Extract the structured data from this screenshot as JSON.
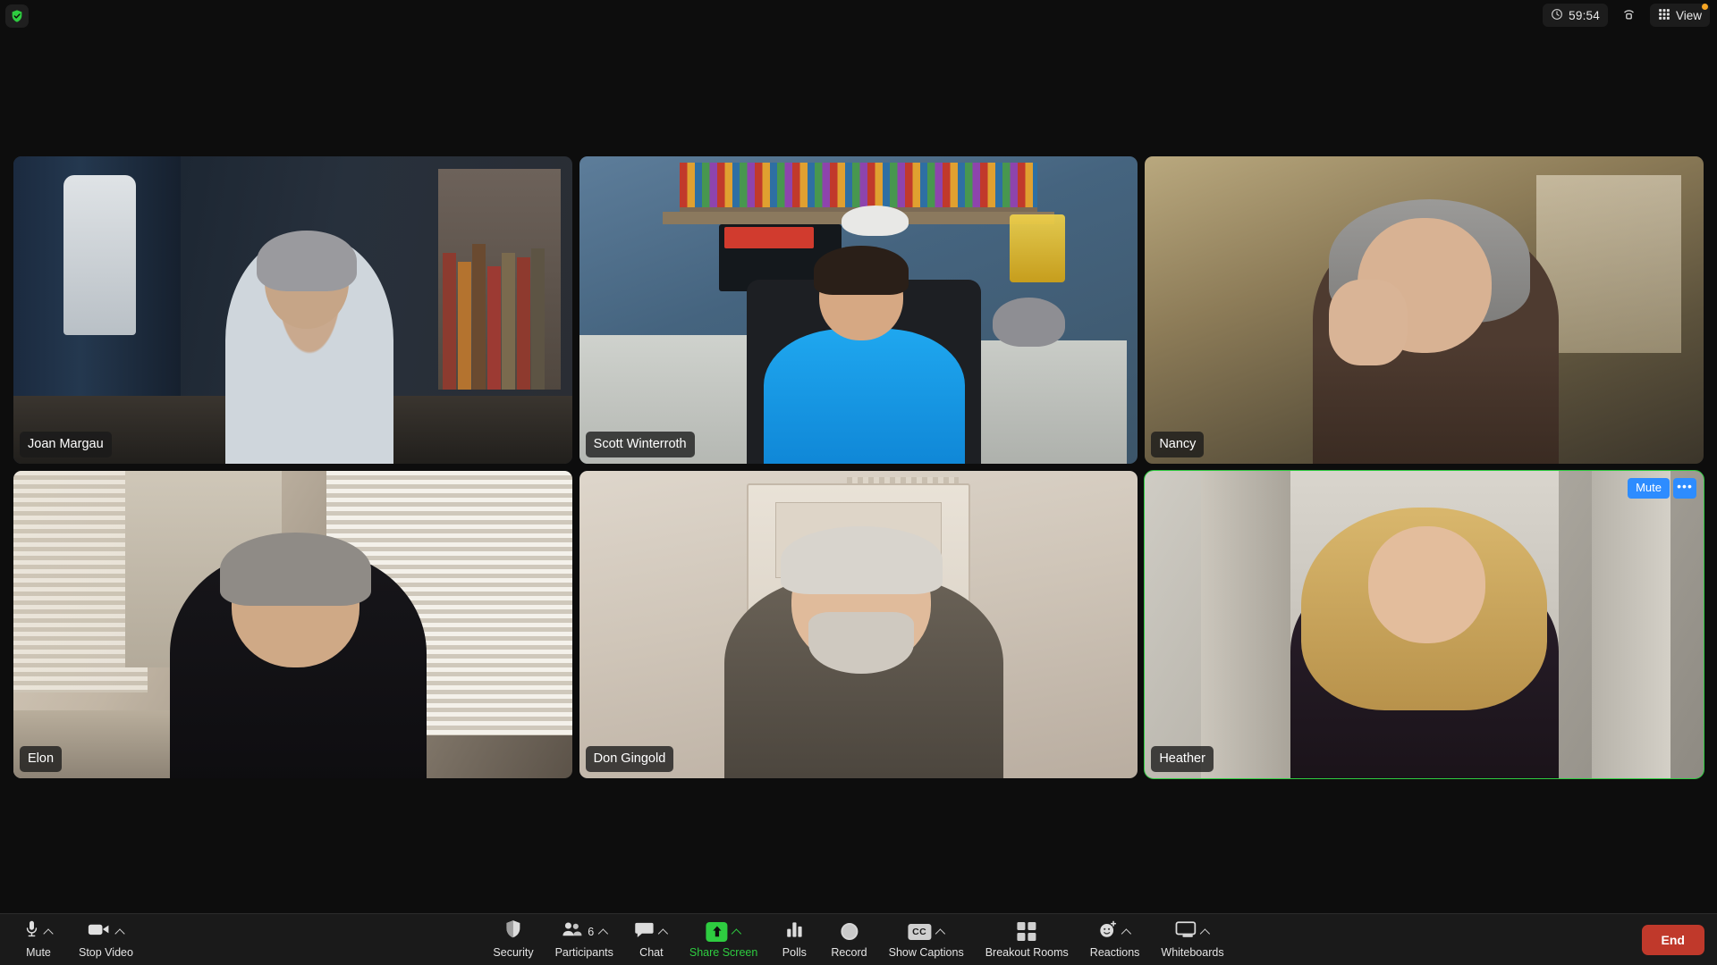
{
  "topbar": {
    "encryption_icon": "shield-check-icon",
    "timer": "59:54",
    "timer_icon": "clock-icon",
    "connection_icon": "network-signal-icon",
    "view_label": "View",
    "view_icon": "grid-icon",
    "view_badge_color": "#f5a524"
  },
  "grid": {
    "tiles": [
      {
        "name": "Joan Margau",
        "active": false,
        "scene": "joan"
      },
      {
        "name": "Scott Winterroth",
        "active": false,
        "scene": "scott"
      },
      {
        "name": "Nancy",
        "active": false,
        "scene": "nancy"
      },
      {
        "name": "Elon",
        "active": false,
        "scene": "elon"
      },
      {
        "name": "Don Gingold",
        "active": false,
        "scene": "don"
      },
      {
        "name": "Heather",
        "active": true,
        "scene": "heather",
        "controls": {
          "mute_label": "Mute",
          "more_label": "•••"
        }
      }
    ],
    "active_border_color": "#2ecc40"
  },
  "toolbar": {
    "left": [
      {
        "label": "Mute",
        "icon": "microphone-icon",
        "chevron": true
      },
      {
        "label": "Stop Video",
        "icon": "video-camera-icon",
        "chevron": true
      }
    ],
    "center": [
      {
        "label": "Security",
        "icon": "shield-icon",
        "chevron": false
      },
      {
        "label": "Participants",
        "icon": "people-icon",
        "chevron": true,
        "count": "6"
      },
      {
        "label": "Chat",
        "icon": "chat-bubble-icon",
        "chevron": true
      },
      {
        "label": "Share Screen",
        "icon": "share-arrow-up-icon",
        "chevron": true,
        "highlight": "#2ecc40"
      },
      {
        "label": "Polls",
        "icon": "bar-chart-icon",
        "chevron": false
      },
      {
        "label": "Record",
        "icon": "record-circle-icon",
        "chevron": false
      },
      {
        "label": "Show Captions",
        "icon": "cc-icon",
        "chevron": true,
        "badge_text": "CC"
      },
      {
        "label": "Breakout Rooms",
        "icon": "grid-squares-icon",
        "chevron": false
      },
      {
        "label": "Reactions",
        "icon": "smiley-plus-icon",
        "chevron": true
      },
      {
        "label": "Whiteboards",
        "icon": "whiteboard-icon",
        "chevron": true
      }
    ],
    "end_button": {
      "label": "End",
      "color": "#c0392b"
    }
  }
}
